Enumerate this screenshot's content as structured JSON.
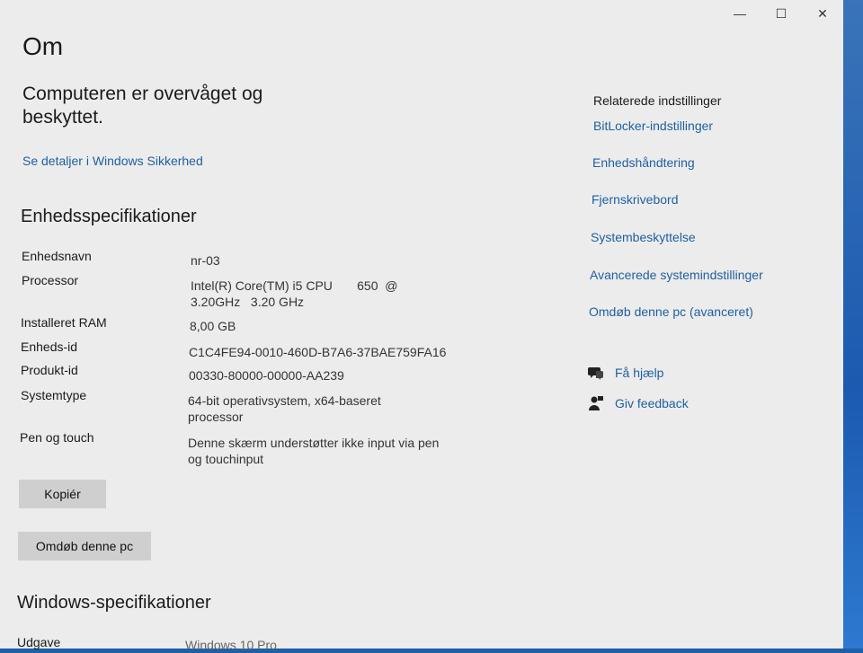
{
  "window": {
    "controls": {
      "minimize": "—",
      "maximize": "☐",
      "close": "✕"
    }
  },
  "page": {
    "title": "Om"
  },
  "security": {
    "heading": "Computeren er overvåget og beskyttet.",
    "link": "Se detaljer i Windows Sikkerhed"
  },
  "device_specs": {
    "heading": "Enhedsspecifikationer",
    "rows": [
      {
        "label": "Enhedsnavn",
        "value": "nr-03"
      },
      {
        "label": "Processor",
        "value": "Intel(R) Core(TM) i5 CPU       650  @ 3.20GHz   3.20 GHz"
      },
      {
        "label": "Installeret RAM",
        "value": "8,00 GB"
      },
      {
        "label": "Enheds-id",
        "value": "C1C4FE94-0010-460D-B7A6-37BAE759FA16"
      },
      {
        "label": "Produkt-id",
        "value": "00330-80000-00000-AA239"
      },
      {
        "label": "Systemtype",
        "value": "64-bit operativsystem, x64-baseret processor"
      },
      {
        "label": "Pen og touch",
        "value": "Denne skærm understøtter ikke input via pen og touchinput"
      }
    ],
    "copy_button": "Kopiér",
    "rename_button": "Omdøb denne pc"
  },
  "windows_specs": {
    "heading": "Windows-specifikationer",
    "rows": [
      {
        "label": "Udgave",
        "value": "Windows 10 Pro"
      }
    ]
  },
  "related": {
    "heading": "Relaterede indstillinger",
    "links": [
      "BitLocker-indstillinger",
      "Enhedshåndtering",
      "Fjernskrivebord",
      "Systembeskyttelse",
      "Avancerede systemindstillinger",
      "Omdøb denne pc (avanceret)"
    ]
  },
  "help": {
    "get_help": "Få hjælp",
    "feedback": "Giv feedback",
    "icons": {
      "get_help": "help-chat-icon",
      "feedback": "feedback-icon"
    }
  },
  "colors": {
    "link": "#1f5fa0",
    "background": "#ececec",
    "button": "#cfcfcf"
  }
}
